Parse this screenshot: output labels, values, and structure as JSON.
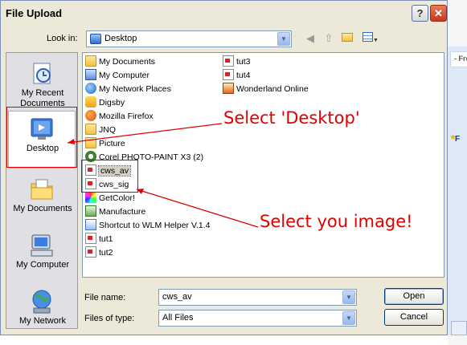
{
  "window": {
    "title": "File Upload",
    "help_label": "?",
    "close_label": "✕"
  },
  "background": {
    "tab_text": "- Fre",
    "side_text": "F"
  },
  "look_in": {
    "label": "Look in:",
    "value": "Desktop",
    "icon": "desktop-icon"
  },
  "toolbar": {
    "icons": [
      "back-icon",
      "up-folder-icon",
      "new-folder-icon",
      "views-menu-icon"
    ]
  },
  "places": [
    {
      "name": "My Recent Documents",
      "line1": "My Recent",
      "line2": "Documents",
      "icon": "recent-documents-icon",
      "selected": false
    },
    {
      "name": "Desktop",
      "line1": "Desktop",
      "line2": "",
      "icon": "desktop-icon",
      "selected": true
    },
    {
      "name": "My Documents",
      "line1": "My Documents",
      "line2": "",
      "icon": "my-documents-icon",
      "selected": false
    },
    {
      "name": "My Computer",
      "line1": "My Computer",
      "line2": "",
      "icon": "my-computer-icon",
      "selected": false
    },
    {
      "name": "My Network",
      "line1": "My Network",
      "line2": "",
      "icon": "my-network-icon",
      "selected": false
    }
  ],
  "files": {
    "col1": [
      {
        "name": "My Documents",
        "icon": "folder"
      },
      {
        "name": "My Computer",
        "icon": "computer"
      },
      {
        "name": "My Network Places",
        "icon": "network"
      },
      {
        "name": "Digsby",
        "icon": "digsby"
      },
      {
        "name": "Mozilla Firefox",
        "icon": "firefox"
      },
      {
        "name": "JNQ",
        "icon": "folder"
      },
      {
        "name": "Picture",
        "icon": "folder"
      },
      {
        "name": "Corel PHOTO-PAINT X3 (2)",
        "icon": "corel"
      },
      {
        "name": "cws_av",
        "icon": "image",
        "selected": true
      },
      {
        "name": "cws_sig",
        "icon": "image"
      },
      {
        "name": "GetColor!",
        "icon": "getcolor"
      },
      {
        "name": "Manufacture",
        "icon": "excel"
      },
      {
        "name": "Shortcut to WLM Helper V.1.4",
        "icon": "wlm"
      },
      {
        "name": "tut1",
        "icon": "image"
      },
      {
        "name": "tut2",
        "icon": "image"
      }
    ],
    "col2": [
      {
        "name": "tut3",
        "icon": "image"
      },
      {
        "name": "tut4",
        "icon": "image"
      },
      {
        "name": "Wonderland Online",
        "icon": "wonderland"
      }
    ]
  },
  "file_name": {
    "label": "File name:",
    "value": "cws_av"
  },
  "file_type": {
    "label": "Files of type:",
    "value": "All Files"
  },
  "buttons": {
    "open": "Open",
    "cancel": "Cancel"
  },
  "annotations": {
    "select_desktop": "Select 'Desktop'",
    "select_image": "Select you image!",
    "color": "#e10000"
  }
}
